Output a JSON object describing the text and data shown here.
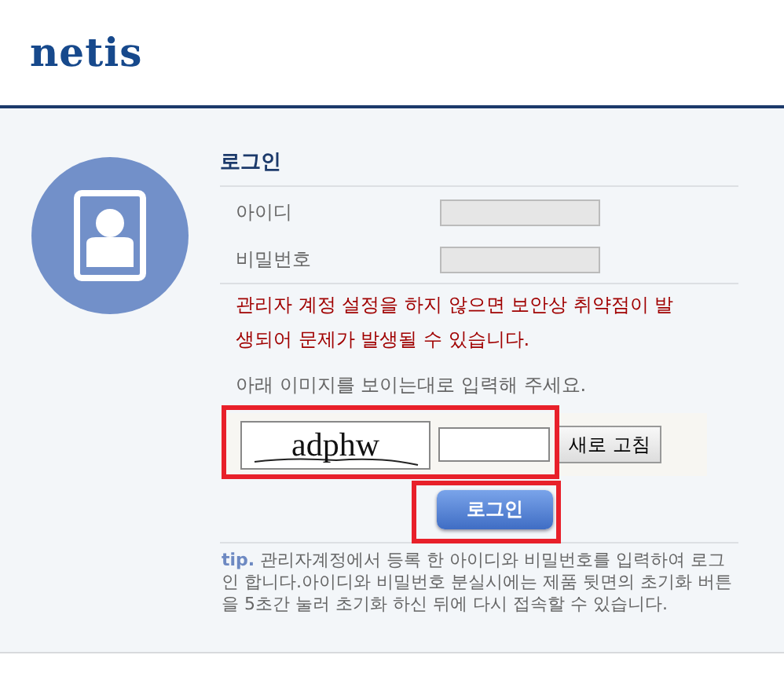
{
  "logo": "netis",
  "login": {
    "title": "로그인",
    "fields": [
      {
        "label": "아이디"
      },
      {
        "label": "비밀번호"
      }
    ],
    "warning": "관리자 계정 설정을 하지 않으면 보안상 취약점이 발생되어 문제가 발생될 수 있습니다.",
    "captcha": {
      "instruction": "아래 이미지를 보이는대로 입력해 주세요.",
      "code": "adphw",
      "refresh_button": "새로 고침"
    },
    "submit_button": "로그인",
    "tip": {
      "label": "tip.",
      "text": "관리자계정에서 등록 한 아이디와 비밀번호를 입력하여 로그인 합니다.아이디와 비밀번호 분실시에는 제품 뒷면의 초기화 버튼을 5초간 눌러 초기화 하신 뒤에 다시 접속할 수 있습니다."
    }
  }
}
